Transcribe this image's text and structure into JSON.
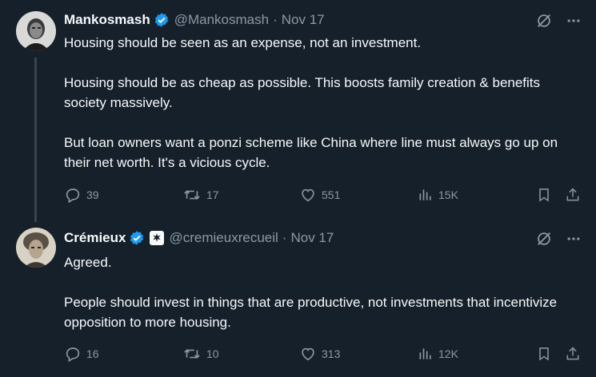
{
  "tweets": [
    {
      "author": {
        "name": "Mankosmash",
        "handle": "@Mankosmash",
        "date": "Nov 17",
        "verified": true
      },
      "text": [
        "Housing should be seen as an expense, not an investment.",
        "Housing should be as cheap as possible. This boosts family creation & benefits society massively.",
        "But loan owners want a ponzi scheme like China where line must always go up on their net worth. It's a vicious cycle."
      ],
      "stats": {
        "replies": "39",
        "reposts": "17",
        "likes": "551",
        "views": "15K"
      }
    },
    {
      "author": {
        "name": "Crémieux",
        "handle": "@cremieuxrecueil",
        "date": "Nov 17",
        "verified": true,
        "affiliate_badge": true
      },
      "text": [
        "Agreed.",
        "People should invest in things that are productive, not investments that incentivize opposition to more housing."
      ],
      "stats": {
        "replies": "16",
        "reposts": "10",
        "likes": "313",
        "views": "12K"
      }
    }
  ],
  "colors": {
    "background": "#15202b",
    "text": "#f7f9f9",
    "muted": "#8b98a5",
    "verified": "#1d9bf0",
    "thread_line": "#38444d"
  },
  "icons": [
    "grok-icon",
    "more-icon",
    "reply-icon",
    "repost-icon",
    "like-icon",
    "views-icon",
    "bookmark-icon",
    "share-icon",
    "verified-badge-icon"
  ]
}
